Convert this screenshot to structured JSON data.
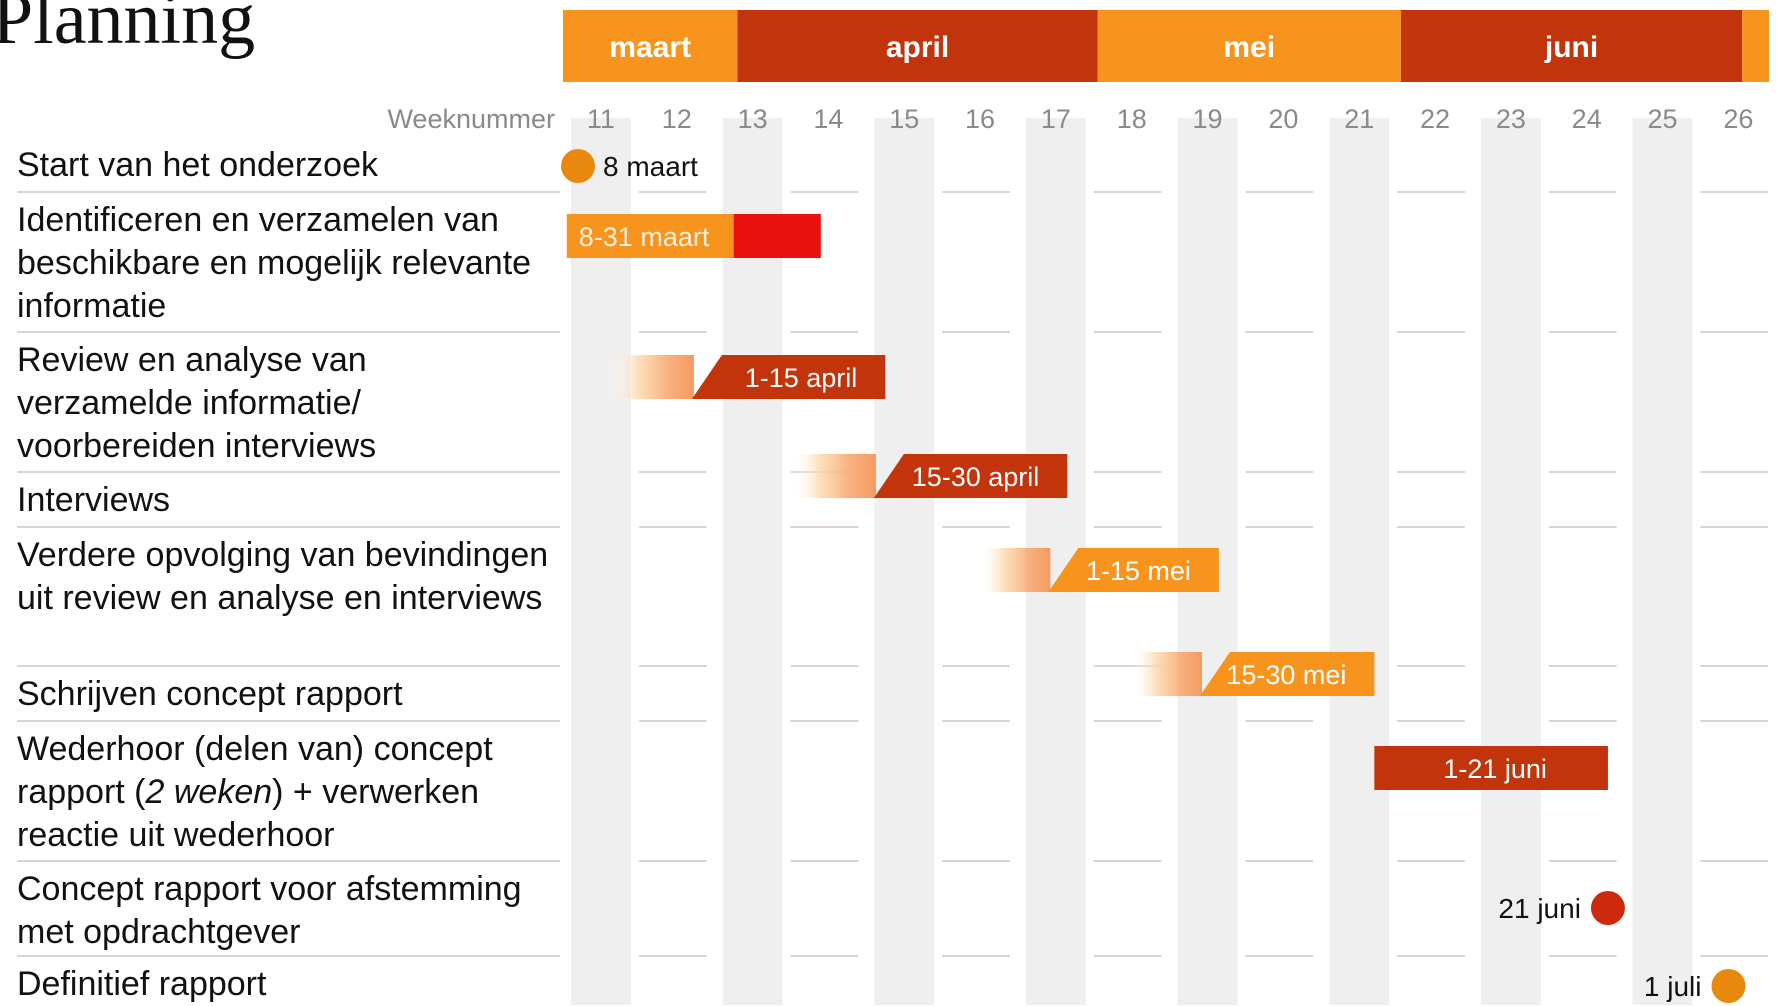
{
  "title": "Planning",
  "colors": {
    "orange": "#f7941d",
    "dark_red": "#c1340c",
    "red": "#e8110e",
    "milestone_orange": "#e8890e",
    "milestone_red": "#cc2a0c",
    "column_shade": "#efefef",
    "row_rule": "#c8c8c8"
  },
  "chart_data": {
    "type": "gantt",
    "months": [
      {
        "name": "maart",
        "color": "orange"
      },
      {
        "name": "april",
        "color": "dark_red"
      },
      {
        "name": "mei",
        "color": "orange"
      },
      {
        "name": "juni",
        "color": "dark_red"
      }
    ],
    "week_axis_label": "Weeknummer",
    "weeks": [
      "11",
      "12",
      "13",
      "14",
      "15",
      "16",
      "17",
      "18",
      "19",
      "20",
      "21",
      "22",
      "23",
      "24",
      "25",
      "26"
    ],
    "tasks": [
      {
        "label": "Start van het onderzoek",
        "type": "milestone",
        "week": 11,
        "text": "8 maart",
        "text_side": "right",
        "color": "milestone_orange"
      },
      {
        "label": "Identificeren en verzamelen van beschikbare en mogelijk relevante informatie",
        "type": "bar",
        "start_week": 11.05,
        "end_week": 14.4,
        "split_week": 13.25,
        "text": "8-31 maart",
        "color": "orange",
        "tail_color": "red"
      },
      {
        "label": "Review en analyse van verzamelde informatie/ voorbereiden interviews",
        "type": "bar",
        "start_week": 11.6,
        "end_week": 15.25,
        "fade_end_week": 12.7,
        "text": "1-15 april",
        "color": "dark_red"
      },
      {
        "label": "Interviews",
        "type": "bar",
        "start_week": 14.0,
        "end_week": 17.65,
        "fade_end_week": 15.1,
        "text": "15-30 april",
        "color": "dark_red"
      },
      {
        "label": "Verdere opvolging van bevindingen uit review en analyse en interviews",
        "type": "bar",
        "start_week": 16.5,
        "end_week": 19.65,
        "fade_end_week": 17.4,
        "text": "1-15 mei",
        "color": "orange"
      },
      {
        "label": "Schrijven concept rapport",
        "type": "bar",
        "start_week": 18.5,
        "end_week": 21.7,
        "fade_end_week": 19.4,
        "text": "15-30 mei",
        "color": "orange"
      },
      {
        "label": "Wederhoor (delen van) concept rapport (2 weken) + verwerken reactie uit wederhoor",
        "type": "bar",
        "start_week": 21.7,
        "end_week": 24.78,
        "text": "1-21 juni",
        "color": "dark_red"
      },
      {
        "label": "Concept rapport voor afstemming met opdrachtgever",
        "type": "milestone",
        "week": 24.78,
        "text": "21 juni",
        "text_side": "left",
        "color": "milestone_red"
      },
      {
        "label": "Definitief rapport",
        "type": "milestone",
        "week": 26.37,
        "text": "1 juli",
        "text_side": "left",
        "color": "milestone_orange"
      }
    ]
  }
}
